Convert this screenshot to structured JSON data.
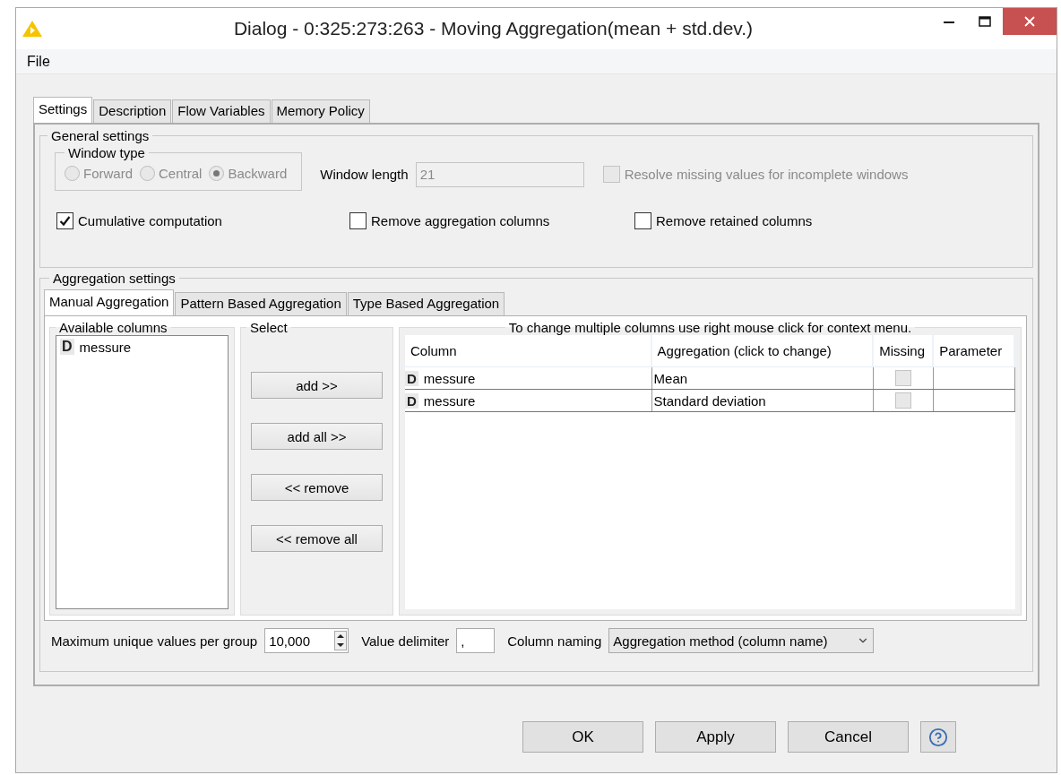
{
  "window": {
    "title": "Dialog - 0:325:273:263 - Moving Aggregation(mean + std.dev.)"
  },
  "menu": [
    "File"
  ],
  "tabs": [
    {
      "label": "Settings",
      "selected": true
    },
    {
      "label": "Description",
      "selected": false
    },
    {
      "label": "Flow Variables",
      "selected": false
    },
    {
      "label": "Memory Policy",
      "selected": false
    }
  ],
  "general_settings": {
    "title": "General settings",
    "window_type": {
      "title": "Window type",
      "disabled": true,
      "options": [
        {
          "label": "Forward",
          "selected": false
        },
        {
          "label": "Central",
          "selected": false
        },
        {
          "label": "Backward",
          "selected": true
        }
      ]
    },
    "window_length": {
      "label": "Window length",
      "value": "21",
      "disabled": true
    },
    "resolve_missing": {
      "label": "Resolve missing values for incomplete windows",
      "checked": false,
      "disabled": true
    },
    "checkboxes": [
      {
        "label": "Cumulative computation",
        "checked": true
      },
      {
        "label": "Remove aggregation columns",
        "checked": false
      },
      {
        "label": "Remove retained columns",
        "checked": false
      }
    ]
  },
  "aggregation_settings": {
    "title": "Aggregation settings",
    "tabs": [
      {
        "label": "Manual Aggregation",
        "selected": true
      },
      {
        "label": "Pattern Based Aggregation",
        "selected": false
      },
      {
        "label": "Type Based Aggregation",
        "selected": false
      }
    ],
    "available_columns": {
      "title": "Available columns",
      "items": [
        {
          "type": "D",
          "name": "messure"
        }
      ]
    },
    "select": {
      "title": "Select",
      "buttons": [
        "add >>",
        "add all >>",
        "<< remove",
        "<< remove all"
      ]
    },
    "table": {
      "hint": "To change multiple columns use right mouse click for context menu.",
      "columns": [
        "Column",
        "Aggregation (click to change)",
        "Missing",
        "Parameter"
      ],
      "rows": [
        {
          "type": "D",
          "column": "messure",
          "aggregation": "Mean",
          "missing": false
        },
        {
          "type": "D",
          "column": "messure",
          "aggregation": "Standard deviation",
          "missing": false
        }
      ]
    },
    "max_unique": {
      "label": "Maximum unique values per group",
      "value": "10,000"
    },
    "delimiter": {
      "label": "Value delimiter",
      "value": ","
    },
    "column_naming": {
      "label": "Column naming",
      "value": "Aggregation method (column name)"
    }
  },
  "buttons": [
    "OK",
    "Apply",
    "Cancel"
  ]
}
